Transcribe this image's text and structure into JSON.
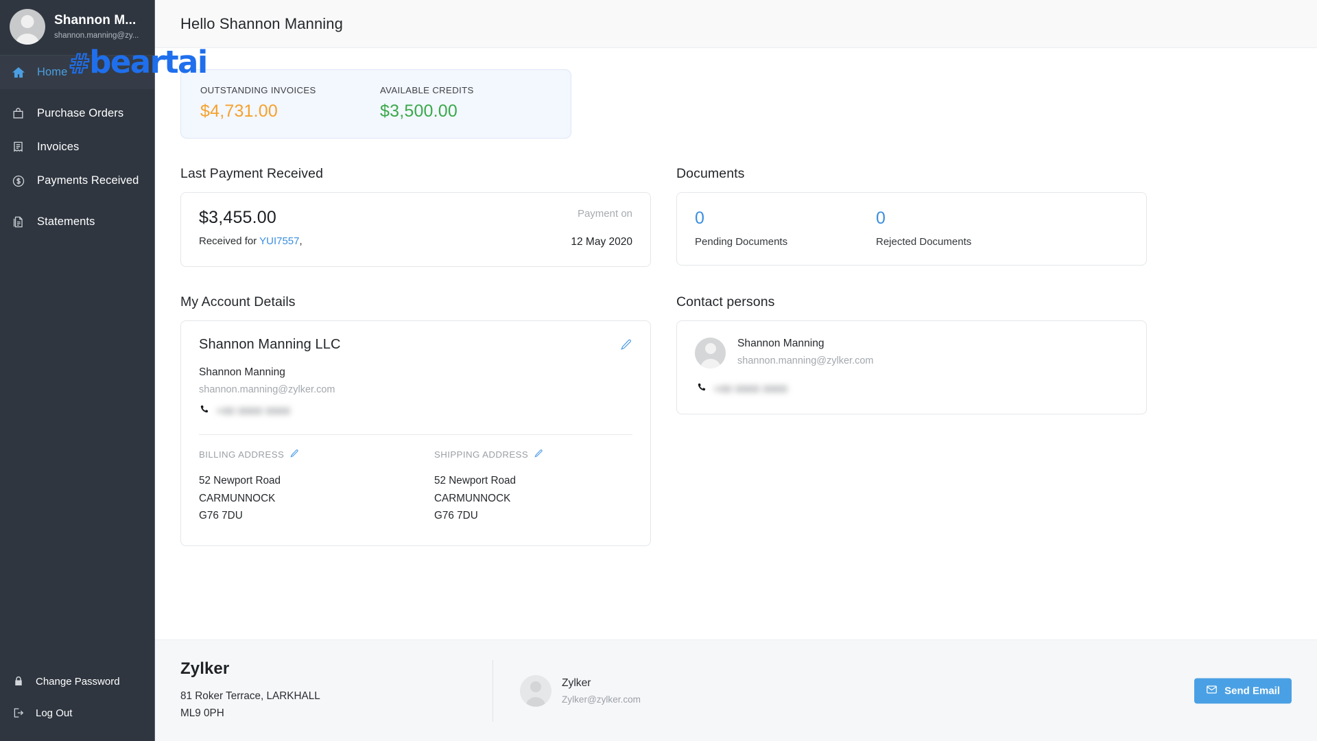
{
  "watermark": {
    "hash": "#",
    "word": "beartai"
  },
  "sidebar": {
    "profile": {
      "name": "Shannon M...",
      "email": "shannon.manning@zy...",
      "avatar_icon": "user-avatar-icon"
    },
    "items": [
      {
        "label": "Home",
        "icon": "home-icon",
        "active": true
      },
      {
        "label": "Purchase Orders",
        "icon": "bag-icon",
        "active": false
      },
      {
        "label": "Invoices",
        "icon": "invoice-icon",
        "active": false
      },
      {
        "label": "Payments Received",
        "icon": "dollar-circle-icon",
        "active": false
      },
      {
        "label": "Statements",
        "icon": "document-stack-icon",
        "active": false
      }
    ],
    "bottom_items": [
      {
        "label": "Change Password",
        "icon": "lock-icon"
      },
      {
        "label": "Log Out",
        "icon": "logout-icon"
      }
    ]
  },
  "header": {
    "greeting": "Hello Shannon Manning"
  },
  "stats": {
    "outstanding": {
      "label": "OUTSTANDING INVOICES",
      "value": "$4,731.00",
      "color": "#f5a22d"
    },
    "credits": {
      "label": "AVAILABLE CREDITS",
      "value": "$3,500.00",
      "color": "#3aa94b"
    }
  },
  "last_payment": {
    "title": "Last Payment Received",
    "amount": "$3,455.00",
    "received_prefix": "Received for ",
    "reference": "YUI7557",
    "received_suffix": ",",
    "payment_on_label": "Payment on",
    "date": "12 May 2020"
  },
  "documents": {
    "title": "Documents",
    "pending": {
      "count": "0",
      "label": "Pending Documents"
    },
    "rejected": {
      "count": "0",
      "label": "Rejected Documents"
    }
  },
  "account": {
    "title": "My Account Details",
    "company": "Shannon Manning LLC",
    "person": "Shannon Manning",
    "email": "shannon.manning@zylker.com",
    "phone": "+00 0000 0000",
    "edit_icon": "pencil-edit-icon",
    "billing": {
      "label": "BILLING ADDRESS",
      "lines": [
        "52 Newport Road",
        "CARMUNNOCK",
        "G76 7DU"
      ]
    },
    "shipping": {
      "label": "SHIPPING ADDRESS",
      "lines": [
        "52 Newport Road",
        "CARMUNNOCK",
        "G76 7DU"
      ]
    }
  },
  "contacts": {
    "title": "Contact persons",
    "person": {
      "name": "Shannon Manning",
      "email": "shannon.manning@zylker.com",
      "phone": "+00 0000 0000"
    }
  },
  "footer": {
    "org_name": "Zylker",
    "address_line1": "81 Roker Terrace, LARKHALL",
    "address_line2": "ML9 0PH",
    "contact_name": "Zylker",
    "contact_email": "Zylker@zylker.com",
    "send_email_label": "Send Email",
    "send_email_color": "#4aa0e4"
  }
}
